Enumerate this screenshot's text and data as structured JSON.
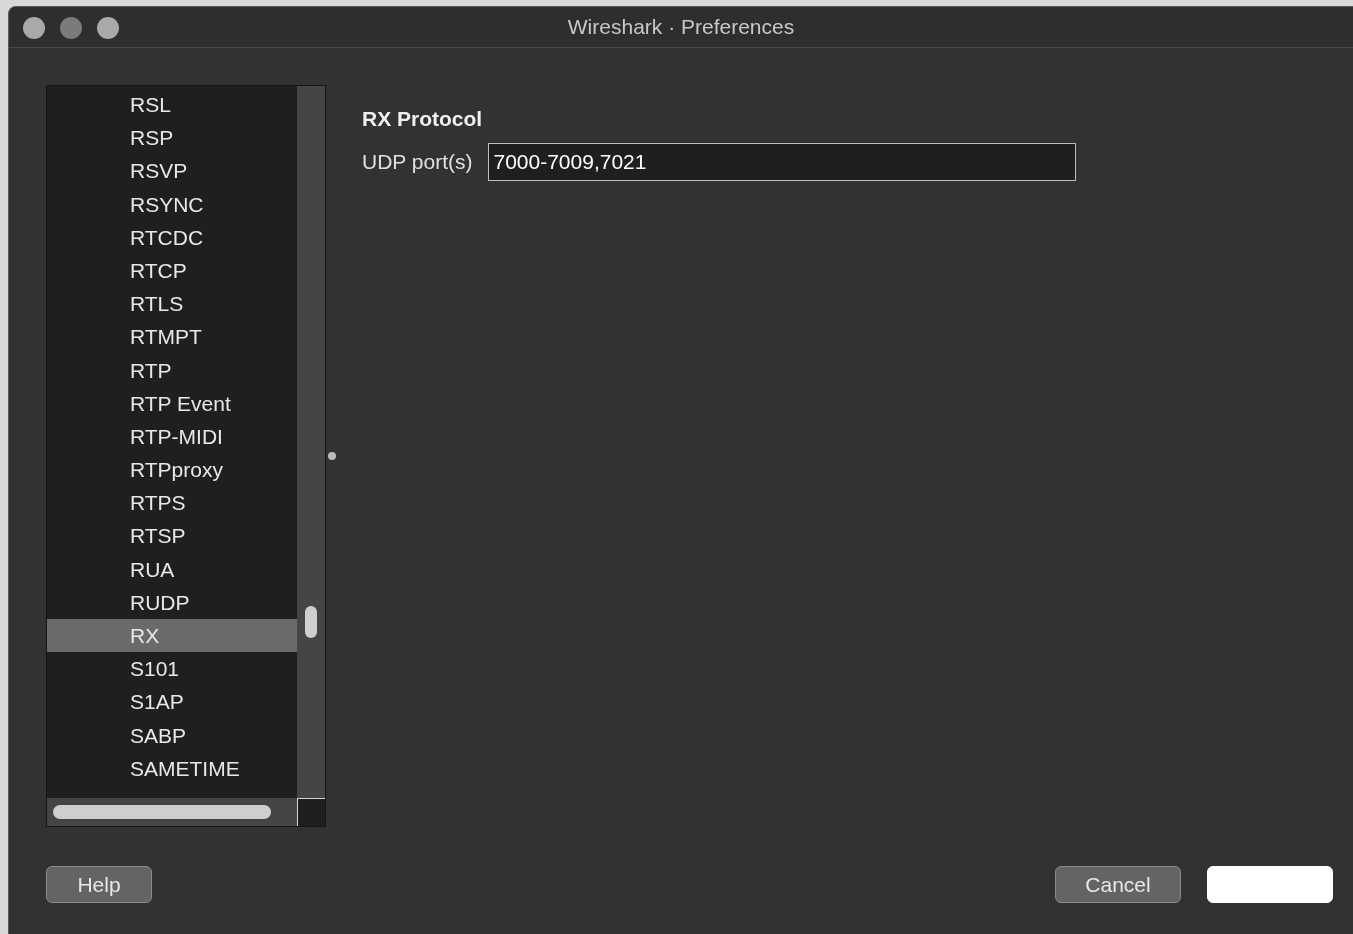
{
  "window": {
    "title": "Wireshark · Preferences"
  },
  "sidebar": {
    "items": [
      {
        "label": "RSL",
        "selected": false
      },
      {
        "label": "RSP",
        "selected": false
      },
      {
        "label": "RSVP",
        "selected": false
      },
      {
        "label": "RSYNC",
        "selected": false
      },
      {
        "label": "RTCDC",
        "selected": false
      },
      {
        "label": "RTCP",
        "selected": false
      },
      {
        "label": "RTLS",
        "selected": false
      },
      {
        "label": "RTMPT",
        "selected": false
      },
      {
        "label": "RTP",
        "selected": false
      },
      {
        "label": "RTP Event",
        "selected": false
      },
      {
        "label": "RTP-MIDI",
        "selected": false
      },
      {
        "label": "RTPproxy",
        "selected": false
      },
      {
        "label": "RTPS",
        "selected": false
      },
      {
        "label": "RTSP",
        "selected": false
      },
      {
        "label": "RUA",
        "selected": false
      },
      {
        "label": "RUDP",
        "selected": false
      },
      {
        "label": "RX",
        "selected": true
      },
      {
        "label": "S101",
        "selected": false
      },
      {
        "label": "S1AP",
        "selected": false
      },
      {
        "label": "SABP",
        "selected": false
      },
      {
        "label": "SAMETIME",
        "selected": false
      }
    ]
  },
  "panel": {
    "heading": "RX Protocol",
    "fields": [
      {
        "label": "UDP port(s)",
        "value": "7000-7009,7021"
      }
    ]
  },
  "buttons": [
    {
      "label": "Help",
      "kind": "normal"
    },
    {
      "label": "Cancel",
      "kind": "normal"
    },
    {
      "kind": "default"
    }
  ]
}
